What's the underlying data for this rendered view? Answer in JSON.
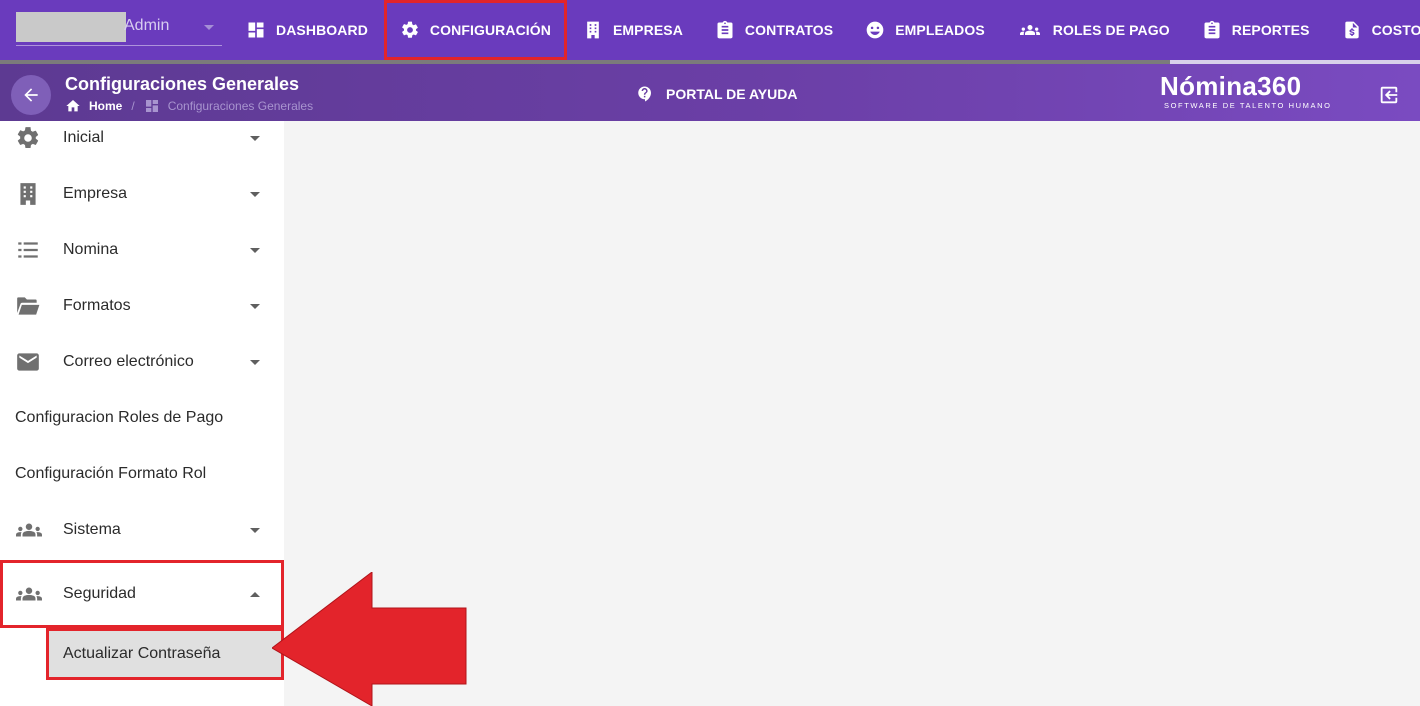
{
  "header": {
    "user_name": "Admin",
    "nav": [
      {
        "label": "DASHBOARD",
        "icon": "dashboard-icon"
      },
      {
        "label": "CONFIGURACIÓN",
        "icon": "gear-icon",
        "active": true
      },
      {
        "label": "EMPRESA",
        "icon": "building-icon"
      },
      {
        "label": "CONTRATOS",
        "icon": "clipboard-icon"
      },
      {
        "label": "EMPLEADOS",
        "icon": "face-icon"
      },
      {
        "label": "ROLES DE PAGO",
        "icon": "group-icon"
      },
      {
        "label": "REPORTES",
        "icon": "clipboard-icon"
      },
      {
        "label": "COSTOS",
        "icon": "invoice-icon"
      },
      {
        "label": "",
        "icon": "list-icon"
      }
    ]
  },
  "subheader": {
    "title": "Configuraciones Generales",
    "breadcrumb": {
      "home": "Home",
      "current": "Configuraciones Generales"
    },
    "help_label": "PORTAL DE AYUDA",
    "logo_main": "Nómina360",
    "logo_sub": "SOFTWARE DE TALENTO HUMANO"
  },
  "sidebar": {
    "items": [
      {
        "label": "Inicial",
        "icon": "gear-icon",
        "caret": "down"
      },
      {
        "label": "Empresa",
        "icon": "building-icon",
        "caret": "down"
      },
      {
        "label": "Nomina",
        "icon": "list-icon",
        "caret": "down"
      },
      {
        "label": "Formatos",
        "icon": "folder-open-icon",
        "caret": "down"
      },
      {
        "label": "Correo electrónico",
        "icon": "mail-icon",
        "caret": "down"
      },
      {
        "label": "Configuracion Roles de Pago",
        "icon": "",
        "caret": ""
      },
      {
        "label": "Configuración Formato Rol",
        "icon": "",
        "caret": ""
      },
      {
        "label": "Sistema",
        "icon": "group-icon",
        "caret": "down"
      },
      {
        "label": "Seguridad",
        "icon": "group-icon",
        "caret": "up"
      }
    ],
    "subitem": {
      "label": "Actualizar Contraseña"
    }
  },
  "colors": {
    "topbar": "#6a3bbd",
    "annotation_red": "#e3242b",
    "sidebar_text": "#2b2b2b"
  }
}
